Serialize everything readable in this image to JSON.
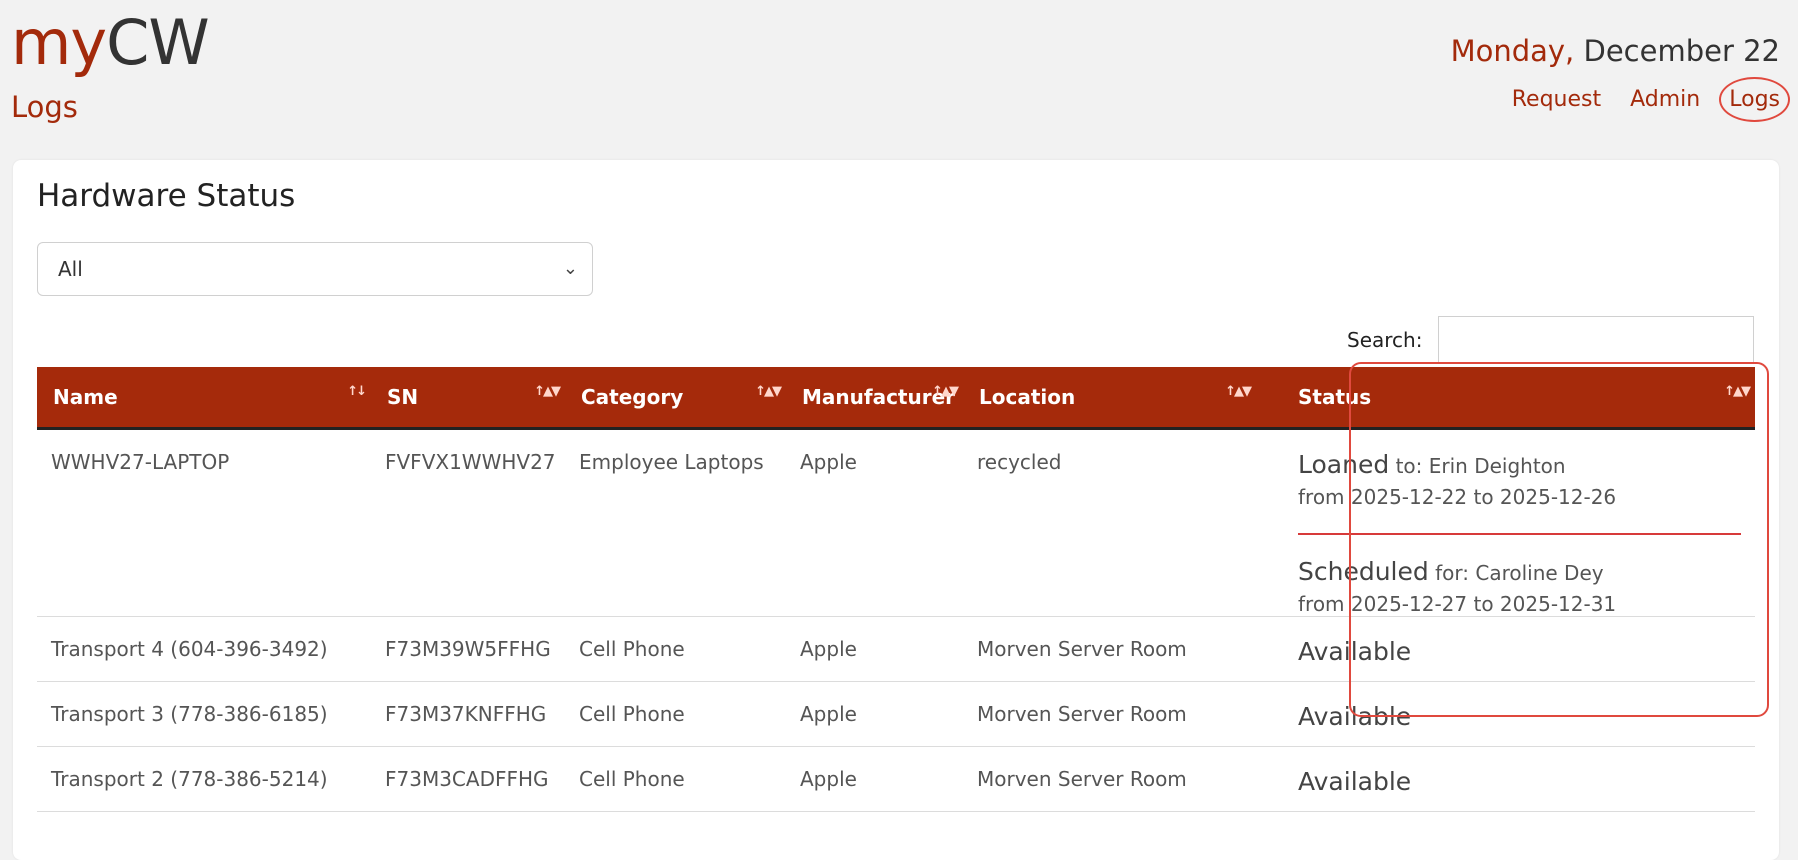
{
  "app": {
    "logo_my": "my",
    "logo_cw": "CW",
    "page_title": "Logs"
  },
  "header": {
    "date_day": "Monday,",
    "date_rest": "December 22",
    "nav": [
      "Request",
      "Admin",
      "Logs"
    ]
  },
  "panel": {
    "title": "Hardware Status",
    "filter_value": "All",
    "search_label": "Search:",
    "search_value": ""
  },
  "table": {
    "columns": [
      "Name",
      "SN",
      "Category",
      "Manufacturer",
      "Location",
      "Status"
    ],
    "rows": [
      {
        "name": "WWHV27-LAPTOP",
        "sn": "FVFVX1WWHV27",
        "category": "Employee Laptops",
        "manufacturer": "Apple",
        "location": "recycled",
        "status": {
          "loan_label": "Loaned",
          "loan_prefix": "to:",
          "loan_person": "Erin Deighton",
          "loan_range": "from 2025-12-22 to 2025-12-26",
          "sched_label": "Scheduled",
          "sched_prefix": "for:",
          "sched_person": "Caroline Dey",
          "sched_range": "from 2025-12-27 to 2025-12-31"
        }
      },
      {
        "name": "Transport 4 (604-396-3492)",
        "sn": "F73M39W5FFHG",
        "category": "Cell Phone",
        "manufacturer": "Apple",
        "location": "Morven Server Room",
        "status": "Available"
      },
      {
        "name": "Transport 3 (778-386-6185)",
        "sn": "F73M37KNFFHG",
        "category": "Cell Phone",
        "manufacturer": "Apple",
        "location": "Morven Server Room",
        "status": "Available"
      },
      {
        "name": "Transport 2 (778-386-5214)",
        "sn": "F73M3CADFFHG",
        "category": "Cell Phone",
        "manufacturer": "Apple",
        "location": "Morven Server Room",
        "status": "Available"
      }
    ]
  },
  "colors": {
    "brand": "#a52a0b",
    "highlight": "#e0493e"
  }
}
